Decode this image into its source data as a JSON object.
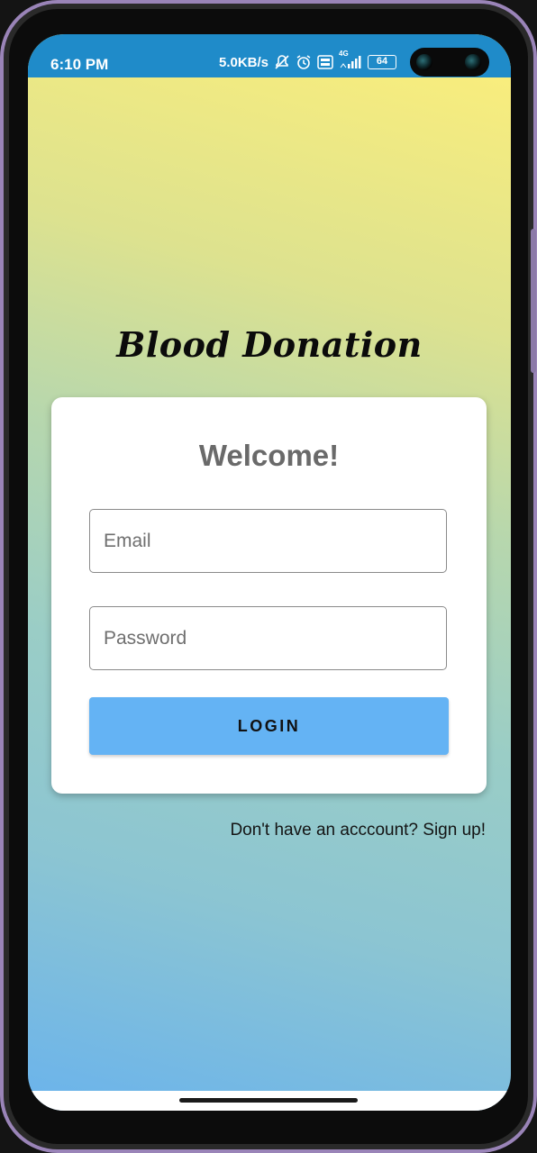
{
  "status_bar": {
    "time": "6:10 PM",
    "network_speed": "5.0KB/s",
    "network_type": "4G",
    "battery_level": "64",
    "icons": [
      "mute-icon",
      "alarm-icon",
      "volte-icon",
      "signal-icon",
      "battery-icon"
    ],
    "color": "#1f8bc9"
  },
  "app": {
    "title": "Blood Donation"
  },
  "login_card": {
    "heading": "Welcome!",
    "email_placeholder": "Email",
    "password_placeholder": "Password",
    "login_label": "LOGIN",
    "button_color": "#64b3f4"
  },
  "signup": {
    "text": "Don't have an acccount? Sign up!"
  }
}
